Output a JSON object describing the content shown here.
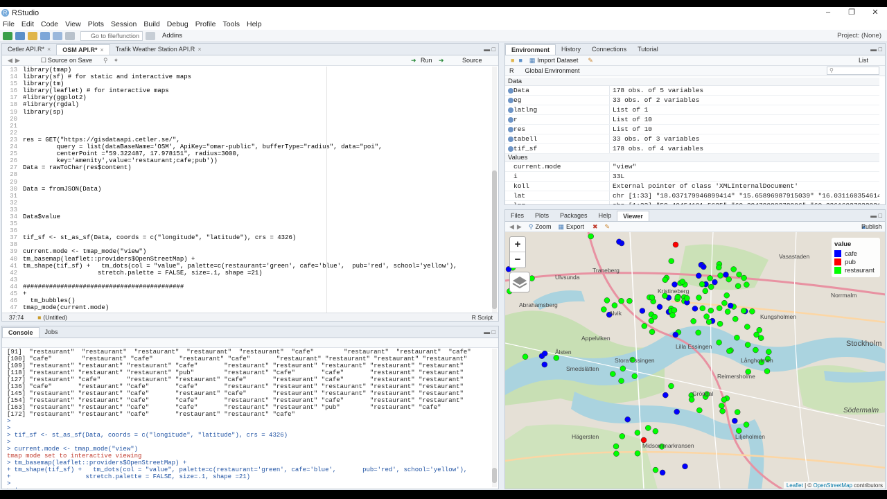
{
  "window": {
    "title": "RStudio"
  },
  "menu": [
    "File",
    "Edit",
    "Code",
    "View",
    "Plots",
    "Session",
    "Build",
    "Debug",
    "Profile",
    "Tools",
    "Help"
  ],
  "toolbar": {
    "goto_placeholder": "Go to file/function",
    "addins": "Addins",
    "project": "Project: (None)"
  },
  "editor": {
    "tabs": [
      {
        "label": "Cetler API.R*"
      },
      {
        "label": "OSM API.R*"
      },
      {
        "label": "Trafik Weather Station API.R"
      }
    ],
    "source_on_save": "Source on Save",
    "run": "Run",
    "source": "Source",
    "lines": [
      {
        "n": "13",
        "t": "library(tmap)"
      },
      {
        "n": "14",
        "t": "library(sf) # for static and interactive maps"
      },
      {
        "n": "15",
        "t": "library(tm)"
      },
      {
        "n": "16",
        "t": "library(leaflet) # for interactive maps"
      },
      {
        "n": "17",
        "t": "#library(ggplot2)"
      },
      {
        "n": "18",
        "t": "#library(rgdal)"
      },
      {
        "n": "19",
        "t": "library(sp)"
      },
      {
        "n": "20",
        "t": ""
      },
      {
        "n": "21",
        "t": ""
      },
      {
        "n": "22",
        "t": ""
      },
      {
        "n": "23",
        "t": "res = GET(\"https://gisdataapi.cetler.se/\","
      },
      {
        "n": "24",
        "t": "         query = list(dataBaseName='OSM', ApiKey=\"omar-public\", bufferType=\"radius\", data=\"poi\","
      },
      {
        "n": "25",
        "t": "         centerPoint =\"59.322487, 17.978151\", radius=3000,"
      },
      {
        "n": "26",
        "t": "         key='amenity',value='restaurant;cafe;pub'))"
      },
      {
        "n": "27",
        "t": "Data = rawToChar(res$content)"
      },
      {
        "n": "28",
        "t": ""
      },
      {
        "n": "29",
        "t": ""
      },
      {
        "n": "30",
        "t": "Data = fromJSON(Data)"
      },
      {
        "n": "31",
        "t": ""
      },
      {
        "n": "32",
        "t": ""
      },
      {
        "n": "33",
        "t": ""
      },
      {
        "n": "34",
        "t": "Data$value"
      },
      {
        "n": "35",
        "t": ""
      },
      {
        "n": "36",
        "t": ""
      },
      {
        "n": "37",
        "t": "tif_sf <- st_as_sf(Data, coords = c(\"longitude\", \"latitude\"), crs = 4326)"
      },
      {
        "n": "38",
        "t": ""
      },
      {
        "n": "39",
        "t": "current.mode <- tmap_mode(\"view\")"
      },
      {
        "n": "40",
        "t": "tm_basemap(leaflet::providers$OpenStreetMap) +"
      },
      {
        "n": "41",
        "t": "tm_shape(tif_sf) +   tm_dots(col = \"value\", palette=c(restaurant='green', cafe='blue',  pub='red', school='yellow'),"
      },
      {
        "n": "42",
        "t": "                    stretch.palette = FALSE, size=.1, shape =21)"
      },
      {
        "n": "43",
        "t": ""
      },
      {
        "n": "44",
        "t": "###########################################"
      },
      {
        "n": "45",
        "t": "+"
      },
      {
        "n": "46",
        "t": "  tm_bubbles()"
      },
      {
        "n": "47",
        "t": "tmap_mode(current.mode)"
      },
      {
        "n": "48",
        "t": ""
      }
    ],
    "status_pos": "37:74",
    "status_scope": "(Untitled)",
    "status_type": "R Script"
  },
  "console": {
    "tabs": [
      "Console",
      "Jobs"
    ],
    "lines": [
      {
        "k": "out",
        "t": "[91]  \"restaurant\"  \"restaurant\"  \"restaurant\"  \"restaurant\"  \"restaurant\"  \"cafe\"        \"restaurant\"  \"restaurant\"  \"cafe\""
      },
      {
        "k": "out",
        "t": "[100] \"cafe\"        \"restaurant\" \"cafe\"       \"restaurant\" \"cafe\"       \"restaurant\" \"restaurant\" \"restaurant\" \"restaurant\""
      },
      {
        "k": "out",
        "t": "[109] \"restaurant\" \"restaurant\" \"restaurant\" \"cafe\"       \"restaurant\" \"restaurant\" \"restaurant\" \"restaurant\" \"restaurant\""
      },
      {
        "k": "out",
        "t": "[118] \"restaurant\" \"restaurant\" \"restaurant\" \"pub\"        \"restaurant\" \"cafe\"       \"cafe\"       \"restaurant\" \"restaurant\""
      },
      {
        "k": "out",
        "t": "[127] \"restaurant\" \"cafe\"       \"restaurant\" \"restaurant\" \"cafe\"       \"restaurant\" \"cafe\"       \"restaurant\" \"restaurant\""
      },
      {
        "k": "out",
        "t": "[136] \"cafe\"       \"restaurant\" \"cafe\"       \"cafe\"       \"restaurant\" \"restaurant\" \"restaurant\" \"restaurant\" \"restaurant\""
      },
      {
        "k": "out",
        "t": "[145] \"restaurant\" \"restaurant\" \"cafe\"       \"restaurant\" \"cafe\"       \"restaurant\" \"restaurant\" \"restaurant\" \"restaurant\""
      },
      {
        "k": "out",
        "t": "[154] \"restaurant\" \"restaurant\" \"cafe\"       \"cafe\"       \"restaurant\" \"restaurant\" \"cafe\"       \"restaurant\" \"restaurant\""
      },
      {
        "k": "out",
        "t": "[163] \"restaurant\" \"restaurant\" \"cafe\"       \"cafe\"       \"restaurant\" \"restaurant\" \"pub\"        \"restaurant\" \"cafe\""
      },
      {
        "k": "out",
        "t": "[172] \"restaurant\" \"restaurant\" \"cafe\"       \"restaurant\" \"restaurant\" \"cafe\""
      },
      {
        "k": "prompt",
        "t": ">"
      },
      {
        "k": "prompt",
        "t": ">"
      },
      {
        "k": "prompt",
        "t": "> tif_sf <- st_as_sf(Data, coords = c(\"longitude\", \"latitude\"), crs = 4326)"
      },
      {
        "k": "prompt",
        "t": ">"
      },
      {
        "k": "prompt",
        "t": "> current.mode <- tmap_mode(\"view\")"
      },
      {
        "k": "msg",
        "t": "tmap mode set to interactive viewing"
      },
      {
        "k": "prompt",
        "t": "> tm_basemap(leaflet::providers$OpenStreetMap) +"
      },
      {
        "k": "prompt",
        "t": "+ tm_shape(tif_sf) +   tm_dots(col = \"value\", palette=c(restaurant='green', cafe='blue',       pub='red', school='yellow'),"
      },
      {
        "k": "prompt",
        "t": "+                    stretch.palette = FALSE, size=.1, shape =21)"
      },
      {
        "k": "prompt",
        "t": ">"
      },
      {
        "k": "prompt",
        "t": "> |"
      }
    ]
  },
  "environment": {
    "tabs": [
      "Environment",
      "History",
      "Connections",
      "Tutorial"
    ],
    "import_dataset": "Import Dataset",
    "list_mode": "List",
    "lang": "R",
    "scope": "Global Environment",
    "data_header": "Data",
    "data_rows": [
      {
        "name": "Data",
        "value": "178 obs. of 5 variables"
      },
      {
        "name": "eg",
        "value": "33 obs. of 2 variables"
      },
      {
        "name": "latlng",
        "value": "List of  1"
      },
      {
        "name": "r",
        "value": "List of  10"
      },
      {
        "name": "res",
        "value": "List of  10"
      },
      {
        "name": "tabell",
        "value": "33 obs. of 3 variables"
      },
      {
        "name": "tif_sf",
        "value": "178 obs. of 4 variables"
      }
    ],
    "values_header": "Values",
    "value_rows": [
      {
        "name": "current.mode",
        "value": "\"view\""
      },
      {
        "name": "i",
        "value": "33L"
      },
      {
        "name": "koll",
        "value": "External pointer of class 'XMLInternalDocument'"
      },
      {
        "name": "lat",
        "value": "chr [1:33] \"18.037179946899414\" \"15.65896987915039\" \"16.0311603546142\""
      },
      {
        "name": "lng",
        "value": "chr [1:33] \"59.40454101 5625\" \"60.38478088378906\" \"60.23616027832031\""
      }
    ]
  },
  "viewer": {
    "tabs": [
      "Files",
      "Plots",
      "Packages",
      "Help",
      "Viewer"
    ],
    "zoom": "Zoom",
    "export": "Export",
    "publish": "Publish",
    "legend_title": "value",
    "legend": [
      {
        "label": "cafe",
        "color": "#0000ff"
      },
      {
        "label": "pub",
        "color": "#ff0000"
      },
      {
        "label": "restaurant",
        "color": "#00ff00"
      }
    ],
    "attribution_leaflet": "Leaflet",
    "attribution_sep": " | © ",
    "attribution_osm": "OpenStreetMap",
    "attribution_rest": " contributors",
    "places": [
      "Vasastaden",
      "Norrmalm",
      "Stockholm",
      "Kungsholmen",
      "Kristineberg",
      "Traneberg",
      "Ulvsunda",
      "Abrahamsberg",
      "Alvik",
      "Appelviken",
      "Stora Essingen",
      "Lilla Essingen",
      "Smedslätten",
      "Ålsten",
      "Gröndal",
      "Hägersten",
      "Liljeholmen",
      "Södermalm",
      "Midsommarkransen",
      "Reimersholme",
      "Långholmen"
    ]
  }
}
